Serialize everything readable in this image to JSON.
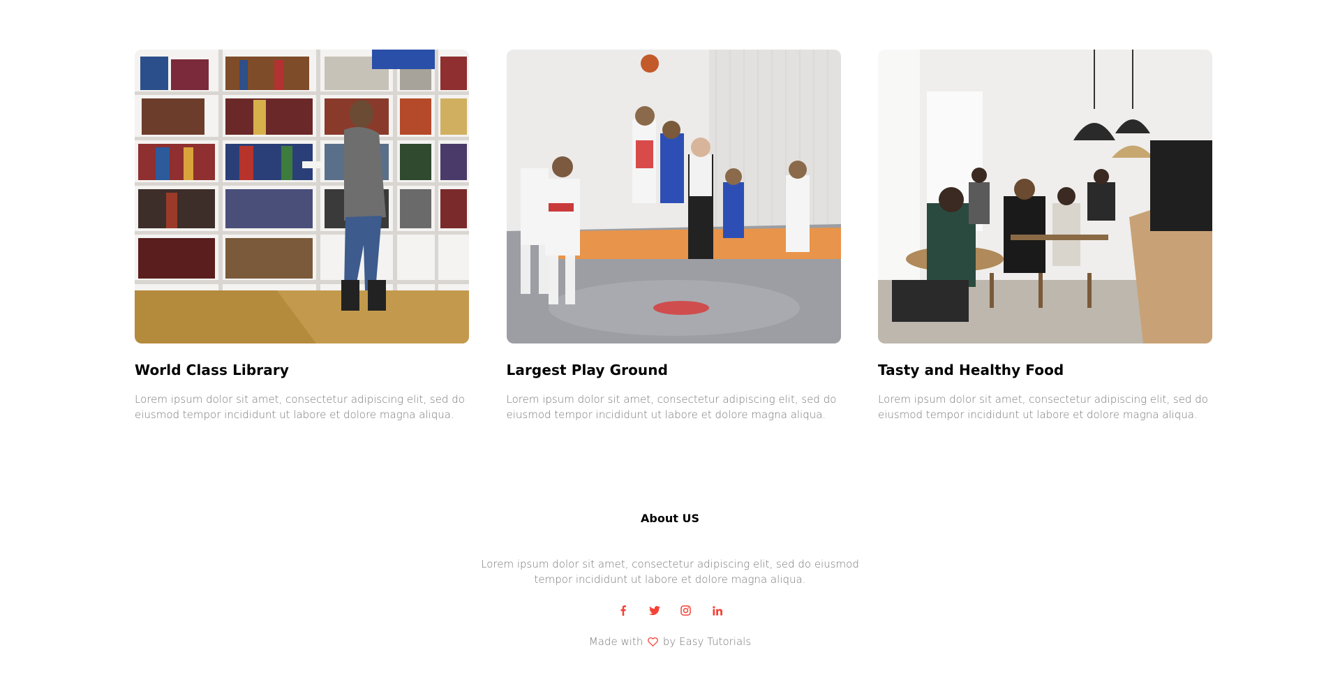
{
  "facilities": [
    {
      "title": "World Class Library",
      "text": "Lorem ipsum dolor sit amet, consectetur adipiscing elit, sed do eiusmod tempor incididunt ut labore et dolore magna aliqua.",
      "image": "library-photo"
    },
    {
      "title": "Largest Play Ground",
      "text": "Lorem ipsum dolor sit amet, consectetur adipiscing elit, sed do eiusmod tempor incididunt ut labore et dolore magna aliqua.",
      "image": "basketball-photo"
    },
    {
      "title": "Tasty and Healthy Food",
      "text": "Lorem ipsum dolor sit amet, consectetur adipiscing elit, sed do eiusmod tempor incididunt ut labore et dolore magna aliqua.",
      "image": "cafeteria-photo"
    }
  ],
  "footer": {
    "title": "About US",
    "text": "Lorem ipsum dolor sit amet, consectetur adipiscing elit, sed do eiusmod tempor incididunt ut labore et dolore magna aliqua.",
    "socials": [
      "facebook-icon",
      "twitter-icon",
      "instagram-icon",
      "linkedin-icon"
    ],
    "made_prefix": "Made with",
    "made_suffix": "by Easy Tutorials"
  },
  "colors": {
    "accent": "#f44336",
    "text_muted": "#777777",
    "heading": "#000000"
  }
}
